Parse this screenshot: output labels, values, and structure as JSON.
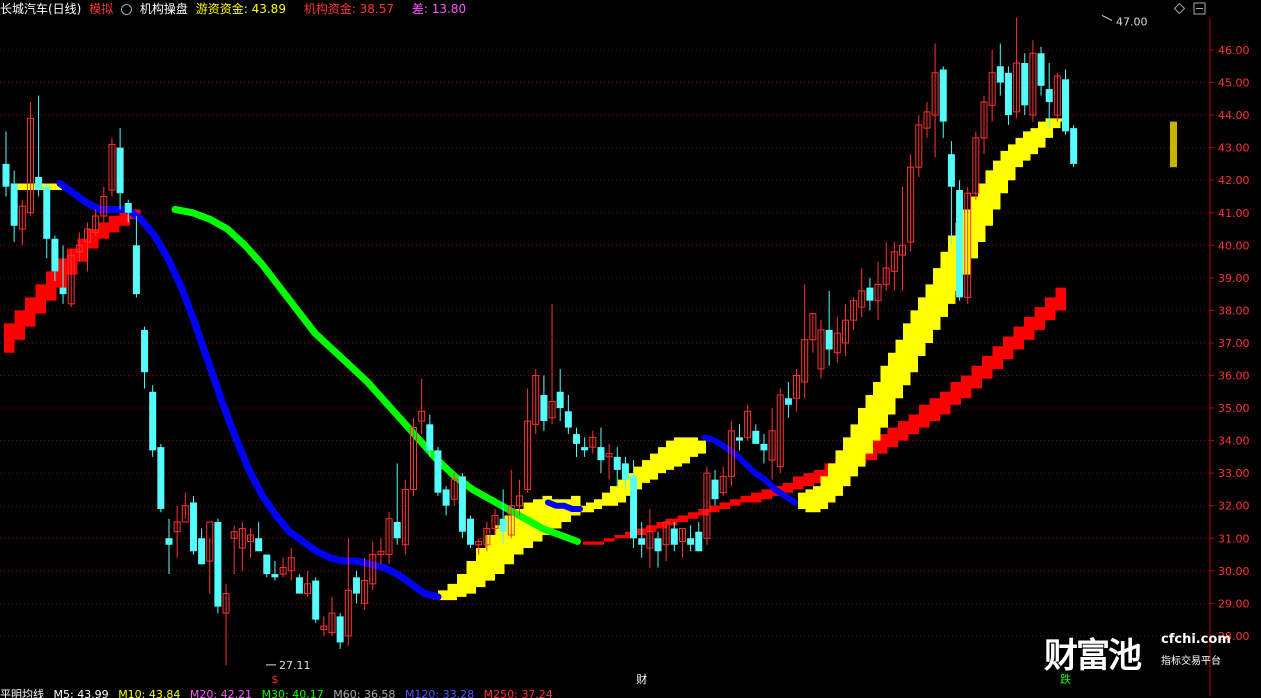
{
  "header": {
    "stock_name": "长城汽车(日线)",
    "mode": "模拟",
    "indicator_name": "机构操盘",
    "hot_money_label": "游资资金:",
    "hot_money_value": "43.89",
    "inst_money_label": "机构资金:",
    "inst_money_value": "38.57",
    "diff_label": "差:",
    "diff_value": "13.80"
  },
  "footer": {
    "ma_name": "平明均线",
    "ma5": "M5: 43.99",
    "ma10": "M10: 43.84",
    "ma20": "M20: 42.21",
    "ma30": "M30: 40.17",
    "ma60": "M60: 36.58",
    "ma120": "M120: 33.28",
    "ma250": "M250: 37.24"
  },
  "watermark": {
    "main": "财富池",
    "site": "cfchi.com",
    "sub": "指标交易平台"
  },
  "colors": {
    "up": "#ff3232",
    "down": "#54fcfc",
    "yellow": "#ffff00",
    "red_band": "#ff0000",
    "blue": "#0000ff",
    "green": "#00ff00",
    "grid": "#8b0000",
    "axis_text": "#ff3232"
  },
  "chart_data": {
    "type": "candlestick",
    "ylim": [
      27.2,
      47.5
    ],
    "y_ticks": [
      "28.00",
      "29.00",
      "30.00",
      "31.00",
      "32.00",
      "33.00",
      "34.00",
      "35.00",
      "36.00",
      "37.00",
      "38.00",
      "39.00",
      "40.00",
      "41.00",
      "42.00",
      "43.00",
      "44.00",
      "45.00",
      "46.00"
    ],
    "high_mark": "47.00",
    "low_mark": "27.11",
    "markers": [
      {
        "label": "$",
        "color": "#ff3232",
        "x": 33
      },
      {
        "label": "财",
        "color": "#ffffff",
        "x": 78
      },
      {
        "label": "跌",
        "color": "#00ff00",
        "x": 130
      }
    ],
    "candles": [
      [
        42.5,
        43.5,
        41.5,
        41.8
      ],
      [
        41.9,
        42.3,
        40.1,
        40.6
      ],
      [
        40.5,
        41.4,
        40.0,
        41.2
      ],
      [
        41.0,
        44.4,
        40.9,
        43.9
      ],
      [
        42.1,
        44.6,
        41.5,
        41.7
      ],
      [
        41.8,
        41.9,
        39.6,
        40.2
      ],
      [
        40.2,
        40.3,
        38.9,
        39.2
      ],
      [
        38.7,
        40.0,
        38.2,
        38.5
      ],
      [
        38.2,
        39.9,
        38.1,
        39.7
      ],
      [
        39.8,
        40.4,
        39.5,
        40.0
      ],
      [
        40.1,
        40.7,
        39.2,
        40.5
      ],
      [
        40.4,
        41.1,
        40.3,
        40.9
      ],
      [
        40.9,
        41.8,
        40.7,
        41.5
      ],
      [
        41.7,
        43.3,
        41.5,
        43.1
      ],
      [
        43.0,
        43.6,
        41.1,
        41.6
      ],
      [
        41.3,
        41.4,
        40.7,
        41.0
      ],
      [
        40.0,
        40.9,
        38.4,
        38.5
      ],
      [
        37.4,
        37.5,
        35.6,
        36.1
      ],
      [
        35.5,
        35.7,
        33.5,
        33.7
      ],
      [
        33.8,
        33.9,
        31.8,
        31.9
      ],
      [
        31.0,
        31.6,
        29.9,
        30.8
      ],
      [
        31.2,
        32.0,
        30.4,
        31.5
      ],
      [
        31.5,
        32.4,
        31.6,
        32.0
      ],
      [
        32.1,
        32.3,
        30.5,
        30.6
      ],
      [
        31.0,
        31.3,
        30.2,
        30.2
      ],
      [
        30.3,
        31.0,
        29.3,
        31.5
      ],
      [
        31.5,
        31.6,
        28.7,
        28.9
      ],
      [
        28.7,
        29.6,
        27.1,
        29.3
      ],
      [
        31.0,
        31.4,
        29.9,
        31.2
      ],
      [
        30.7,
        31.5,
        30.0,
        31.3
      ],
      [
        30.9,
        31.3,
        30.4,
        31.1
      ],
      [
        31.0,
        31.5,
        30.6,
        30.6
      ],
      [
        30.5,
        30.5,
        29.8,
        29.9
      ],
      [
        29.9,
        30.3,
        29.7,
        29.8
      ],
      [
        29.9,
        30.4,
        29.8,
        30.1
      ],
      [
        30.0,
        30.7,
        29.7,
        30.4
      ],
      [
        29.8,
        29.9,
        29.3,
        29.3
      ],
      [
        29.3,
        30.0,
        29.2,
        29.6
      ],
      [
        29.7,
        29.8,
        28.4,
        28.5
      ],
      [
        28.2,
        28.6,
        28.0,
        28.3
      ],
      [
        28.1,
        29.2,
        28.0,
        28.7
      ],
      [
        28.6,
        28.7,
        27.6,
        27.8
      ],
      [
        28.0,
        31.0,
        27.7,
        29.4
      ],
      [
        29.8,
        30.0,
        29.0,
        29.3
      ],
      [
        29.0,
        30.4,
        28.8,
        29.7
      ],
      [
        29.6,
        30.9,
        29.4,
        30.5
      ],
      [
        30.5,
        31.0,
        30.2,
        30.6
      ],
      [
        30.5,
        31.8,
        30.2,
        31.6
      ],
      [
        31.5,
        33.3,
        30.8,
        31.0
      ],
      [
        30.8,
        32.8,
        30.5,
        32.5
      ],
      [
        32.5,
        34.7,
        32.3,
        34.4
      ],
      [
        34.6,
        35.9,
        34.2,
        34.9
      ],
      [
        34.5,
        34.8,
        33.5,
        33.7
      ],
      [
        33.7,
        33.8,
        32.3,
        32.4
      ],
      [
        32.5,
        32.6,
        31.7,
        32.0
      ],
      [
        32.2,
        33.0,
        32.0,
        32.8
      ],
      [
        32.9,
        33.0,
        31.0,
        31.2
      ],
      [
        31.6,
        31.7,
        30.7,
        30.8
      ],
      [
        30.8,
        31.0,
        30.5,
        30.9
      ],
      [
        30.8,
        31.5,
        30.6,
        31.3
      ],
      [
        31.3,
        31.9,
        31.1,
        31.7
      ],
      [
        31.6,
        32.5,
        30.8,
        31.2
      ],
      [
        31.1,
        33.1,
        31.0,
        32.0
      ],
      [
        32.0,
        32.8,
        31.7,
        32.3
      ],
      [
        32.5,
        35.6,
        32.4,
        34.6
      ],
      [
        34.5,
        36.2,
        34.2,
        36.0
      ],
      [
        35.4,
        36.0,
        34.3,
        34.6
      ],
      [
        34.7,
        38.2,
        34.5,
        35.2
      ],
      [
        35.5,
        36.2,
        34.6,
        35.0
      ],
      [
        34.9,
        35.4,
        34.2,
        34.4
      ],
      [
        34.2,
        34.4,
        33.5,
        33.9
      ],
      [
        33.8,
        34.1,
        33.5,
        33.7
      ],
      [
        33.8,
        34.3,
        33.6,
        34.1
      ],
      [
        33.8,
        34.4,
        33.0,
        33.4
      ],
      [
        33.5,
        33.9,
        32.8,
        33.6
      ],
      [
        33.5,
        33.8,
        32.6,
        33.1
      ],
      [
        33.3,
        33.5,
        32.5,
        32.8
      ],
      [
        32.9,
        33.4,
        30.7,
        31.0
      ],
      [
        31.0,
        31.5,
        30.4,
        30.8
      ],
      [
        30.7,
        31.9,
        30.1,
        31.2
      ],
      [
        31.0,
        31.2,
        30.1,
        30.6
      ],
      [
        30.8,
        31.6,
        30.3,
        31.5
      ],
      [
        31.3,
        31.5,
        30.6,
        30.8
      ],
      [
        30.9,
        31.3,
        30.4,
        31.3
      ],
      [
        31.0,
        31.4,
        30.6,
        30.8
      ],
      [
        31.2,
        31.5,
        30.6,
        30.6
      ],
      [
        31.0,
        33.2,
        30.8,
        33.0
      ],
      [
        32.8,
        33.1,
        32.0,
        32.2
      ],
      [
        32.4,
        33.2,
        32.3,
        32.9
      ],
      [
        32.9,
        34.6,
        32.6,
        34.3
      ],
      [
        34.1,
        34.5,
        33.7,
        34.0
      ],
      [
        34.1,
        35.1,
        34.0,
        34.9
      ],
      [
        34.3,
        34.5,
        33.9,
        33.9
      ],
      [
        33.9,
        34.2,
        33.3,
        33.7
      ],
      [
        33.4,
        35.0,
        32.8,
        34.3
      ],
      [
        33.2,
        35.6,
        33.0,
        35.4
      ],
      [
        35.3,
        35.8,
        34.7,
        35.1
      ],
      [
        35.3,
        36.2,
        34.9,
        36.0
      ],
      [
        35.8,
        38.8,
        35.3,
        37.1
      ],
      [
        37.1,
        37.9,
        36.7,
        37.9
      ],
      [
        36.2,
        37.7,
        35.9,
        37.4
      ],
      [
        37.4,
        38.6,
        36.3,
        36.8
      ],
      [
        36.7,
        37.8,
        36.4,
        37.3
      ],
      [
        37.0,
        38.2,
        36.6,
        37.7
      ],
      [
        37.7,
        38.4,
        37.4,
        38.3
      ],
      [
        38.1,
        39.3,
        37.8,
        38.6
      ],
      [
        38.7,
        39.0,
        38.0,
        38.3
      ],
      [
        38.3,
        39.5,
        37.7,
        38.8
      ],
      [
        38.8,
        40.1,
        38.6,
        39.3
      ],
      [
        39.2,
        40.1,
        38.6,
        39.8
      ],
      [
        39.7,
        41.8,
        38.6,
        40.0
      ],
      [
        40.1,
        42.8,
        39.8,
        42.4
      ],
      [
        42.4,
        44.0,
        42.1,
        43.7
      ],
      [
        43.6,
        44.4,
        43.3,
        44.1
      ],
      [
        44.0,
        46.2,
        42.7,
        45.3
      ],
      [
        45.4,
        45.5,
        43.3,
        43.8
      ],
      [
        42.8,
        43.2,
        40.0,
        41.8
      ],
      [
        41.7,
        42.0,
        38.3,
        38.4
      ],
      [
        38.4,
        41.8,
        38.2,
        41.6
      ],
      [
        41.6,
        43.5,
        41.4,
        43.3
      ],
      [
        43.3,
        44.6,
        42.8,
        44.4
      ],
      [
        44.3,
        46.0,
        43.8,
        45.3
      ],
      [
        45.5,
        46.2,
        44.6,
        45.0
      ],
      [
        45.3,
        45.5,
        43.7,
        44.0
      ],
      [
        44.1,
        47.0,
        43.9,
        45.6
      ],
      [
        45.6,
        45.9,
        44.0,
        44.3
      ],
      [
        44.0,
        46.3,
        43.8,
        45.9
      ],
      [
        45.9,
        46.1,
        44.6,
        44.9
      ],
      [
        44.8,
        45.6,
        43.6,
        44.4
      ],
      [
        44.0,
        45.3,
        43.8,
        45.2
      ],
      [
        45.1,
        45.4,
        43.4,
        43.5
      ],
      [
        43.6,
        43.7,
        42.4,
        42.5
      ]
    ],
    "yellow_band": [
      [
        41.9,
        41.7
      ],
      [
        41.9,
        41.7
      ],
      [
        41.9,
        41.7
      ],
      [
        41.9,
        41.7
      ],
      [
        41.9,
        41.7
      ],
      [
        41.9,
        41.7
      ],
      [
        29.4,
        29.1
      ],
      [
        29.6,
        29.1
      ],
      [
        29.9,
        29.2
      ],
      [
        30.3,
        29.3
      ],
      [
        30.7,
        29.5
      ],
      [
        31.1,
        29.7
      ],
      [
        31.4,
        29.9
      ],
      [
        31.7,
        30.2
      ],
      [
        31.9,
        30.5
      ],
      [
        32.1,
        30.7
      ],
      [
        32.2,
        30.9
      ],
      [
        32.3,
        31.1
      ],
      [
        32.2,
        31.3
      ],
      [
        32.2,
        31.5
      ],
      [
        32.3,
        31.7
      ],
      [
        32.0,
        31.8
      ],
      [
        32.1,
        31.8
      ],
      [
        32.2,
        31.9
      ],
      [
        32.4,
        32.0
      ],
      [
        32.6,
        32.0
      ],
      [
        32.8,
        32.1
      ],
      [
        33.0,
        32.3
      ],
      [
        33.2,
        32.5
      ],
      [
        33.4,
        32.7
      ],
      [
        33.6,
        32.8
      ],
      [
        33.8,
        33.0
      ],
      [
        34.0,
        33.1
      ],
      [
        34.1,
        33.2
      ],
      [
        34.1,
        33.3
      ],
      [
        34.1,
        33.5
      ],
      [
        34.0,
        33.6
      ],
      [
        32.4,
        31.9
      ],
      [
        32.5,
        31.8
      ],
      [
        32.6,
        31.8
      ],
      [
        32.9,
        31.9
      ],
      [
        33.3,
        32.1
      ],
      [
        33.7,
        32.3
      ],
      [
        34.1,
        32.6
      ],
      [
        34.5,
        32.9
      ],
      [
        35.0,
        33.2
      ],
      [
        35.4,
        33.6
      ],
      [
        35.8,
        34.0
      ],
      [
        36.3,
        34.4
      ],
      [
        36.7,
        34.8
      ],
      [
        37.1,
        35.3
      ],
      [
        37.6,
        35.7
      ],
      [
        38.0,
        36.1
      ],
      [
        38.4,
        36.6
      ],
      [
        38.8,
        37.0
      ],
      [
        39.3,
        37.4
      ],
      [
        39.8,
        37.8
      ],
      [
        40.3,
        38.2
      ],
      [
        40.7,
        38.6
      ],
      [
        41.1,
        39.1
      ],
      [
        41.5,
        39.6
      ],
      [
        41.9,
        40.1
      ],
      [
        42.3,
        40.6
      ],
      [
        42.6,
        41.1
      ],
      [
        42.9,
        41.6
      ],
      [
        43.1,
        42.0
      ],
      [
        43.3,
        42.4
      ],
      [
        43.5,
        42.6
      ],
      [
        43.6,
        42.8
      ],
      [
        43.8,
        43.0
      ],
      [
        43.9,
        43.3
      ],
      [
        43.9,
        43.6
      ],
      [
        43.9,
        43.8
      ]
    ],
    "red_band": [
      [
        37.6,
        36.7
      ],
      [
        38.0,
        37.1
      ],
      [
        38.4,
        37.5
      ],
      [
        38.8,
        37.9
      ],
      [
        39.2,
        38.3
      ],
      [
        39.6,
        38.7
      ],
      [
        39.9,
        39.1
      ],
      [
        40.2,
        39.5
      ],
      [
        40.5,
        39.9
      ],
      [
        40.7,
        40.2
      ],
      [
        40.9,
        40.4
      ],
      [
        41.0,
        40.6
      ],
      [
        41.1,
        40.8
      ],
      [
        30.9,
        30.8
      ],
      [
        30.9,
        30.8
      ],
      [
        31.0,
        30.9
      ],
      [
        31.1,
        31.0
      ],
      [
        31.2,
        31.0
      ],
      [
        31.3,
        31.1
      ],
      [
        31.4,
        31.2
      ],
      [
        31.5,
        31.3
      ],
      [
        31.6,
        31.4
      ],
      [
        31.7,
        31.5
      ],
      [
        31.8,
        31.6
      ],
      [
        31.9,
        31.7
      ],
      [
        32.0,
        31.8
      ],
      [
        32.1,
        31.9
      ],
      [
        32.2,
        32.0
      ],
      [
        32.3,
        32.1
      ],
      [
        32.4,
        32.1
      ],
      [
        32.5,
        32.2
      ],
      [
        32.6,
        32.3
      ],
      [
        32.7,
        32.4
      ],
      [
        32.9,
        32.5
      ],
      [
        33.0,
        32.6
      ],
      [
        33.1,
        32.7
      ],
      [
        33.3,
        32.9
      ],
      [
        33.4,
        33.0
      ],
      [
        33.6,
        33.1
      ],
      [
        33.8,
        33.3
      ],
      [
        34.0,
        33.4
      ],
      [
        34.2,
        33.6
      ],
      [
        34.4,
        33.8
      ],
      [
        34.6,
        34.0
      ],
      [
        34.8,
        34.2
      ],
      [
        35.1,
        34.4
      ],
      [
        35.3,
        34.6
      ],
      [
        35.5,
        34.8
      ],
      [
        35.8,
        35.1
      ],
      [
        36.0,
        35.3
      ],
      [
        36.3,
        35.6
      ],
      [
        36.6,
        35.9
      ],
      [
        36.9,
        36.2
      ],
      [
        37.2,
        36.5
      ],
      [
        37.5,
        36.8
      ],
      [
        37.8,
        37.1
      ],
      [
        38.1,
        37.4
      ],
      [
        38.4,
        37.7
      ],
      [
        38.7,
        38.0
      ]
    ],
    "blue_line": [
      41.9,
      41.6,
      41.3,
      41.1,
      41.1,
      41.1,
      40.8,
      40.3,
      39.6,
      38.7,
      37.6,
      36.4,
      35.2,
      34.1,
      33.1,
      32.3,
      31.7,
      31.2,
      30.9,
      30.6,
      30.4,
      30.3,
      30.3,
      30.2,
      30.1,
      29.9,
      29.6,
      29.3,
      29.2
    ],
    "blue_line2": [
      32.1,
      32.0,
      32.0,
      31.9,
      31.9
    ],
    "blue_line3": [
      34.1,
      34.0,
      33.8,
      33.6,
      33.3,
      33.0,
      32.8,
      32.5,
      32.3,
      32.1
    ],
    "green_line": [
      41.1,
      41.0,
      40.8,
      40.5,
      40.0,
      39.4,
      38.7,
      38.0,
      37.3,
      36.8,
      36.3,
      35.8,
      35.2,
      34.6,
      34.0,
      33.4,
      32.9,
      32.5,
      32.2,
      31.9,
      31.6,
      31.3,
      31.1,
      30.9
    ],
    "gold_candle": [
      43.8,
      42.4
    ]
  }
}
